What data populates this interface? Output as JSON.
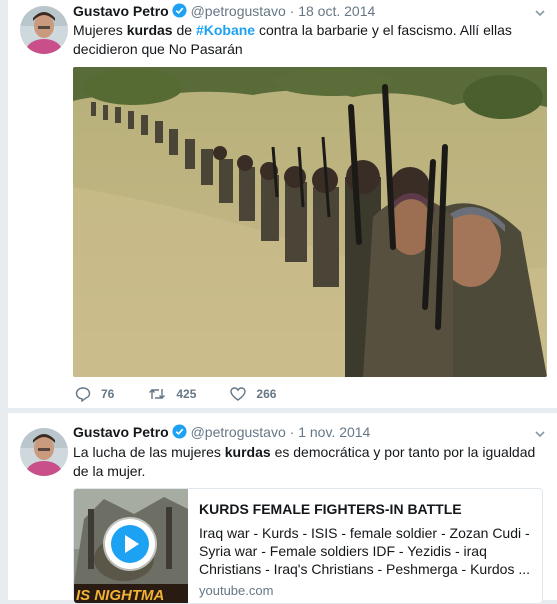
{
  "tweets": [
    {
      "author": "Gustavo Petro",
      "handle": "@petrogustavo",
      "separator": "·",
      "date": "18 oct. 2014",
      "text_parts": [
        "Mujeres ",
        "kurdas",
        " de ",
        "#Kobane",
        " contra la barbarie y el fascismo. Allí ellas decidieron que No Pasarán"
      ],
      "replies": "76",
      "retweets": "425",
      "likes": "266"
    },
    {
      "author": "Gustavo Petro",
      "handle": "@petrogustavo",
      "separator": "·",
      "date": "1 nov. 2014",
      "text_parts": [
        "La lucha de las mujeres ",
        "kurdas",
        " es democrática y por tanto por la igualdad de la mujer."
      ],
      "card": {
        "title": "KURDS FEMALE FIGHTERS-IN BATTLE",
        "description": "Iraq war - Kurds - ISIS - female soldier - Zozan Cudi - Syria war - Female soldiers IDF - Yezidis - iraq Christians - Iraq's Christians - Peshmerga - Kurdos ...",
        "domain": "youtube.com",
        "thumb_caption": "IS NIGHTMA"
      }
    }
  ],
  "colors": {
    "link": "#1da1f2",
    "muted": "#657786",
    "verified": "#1da1f2"
  },
  "icons": {
    "reply": "reply-icon",
    "retweet": "retweet-icon",
    "like": "heart-icon",
    "verified": "verified-badge-icon",
    "caret": "chevron-down-icon",
    "play": "play-icon"
  }
}
